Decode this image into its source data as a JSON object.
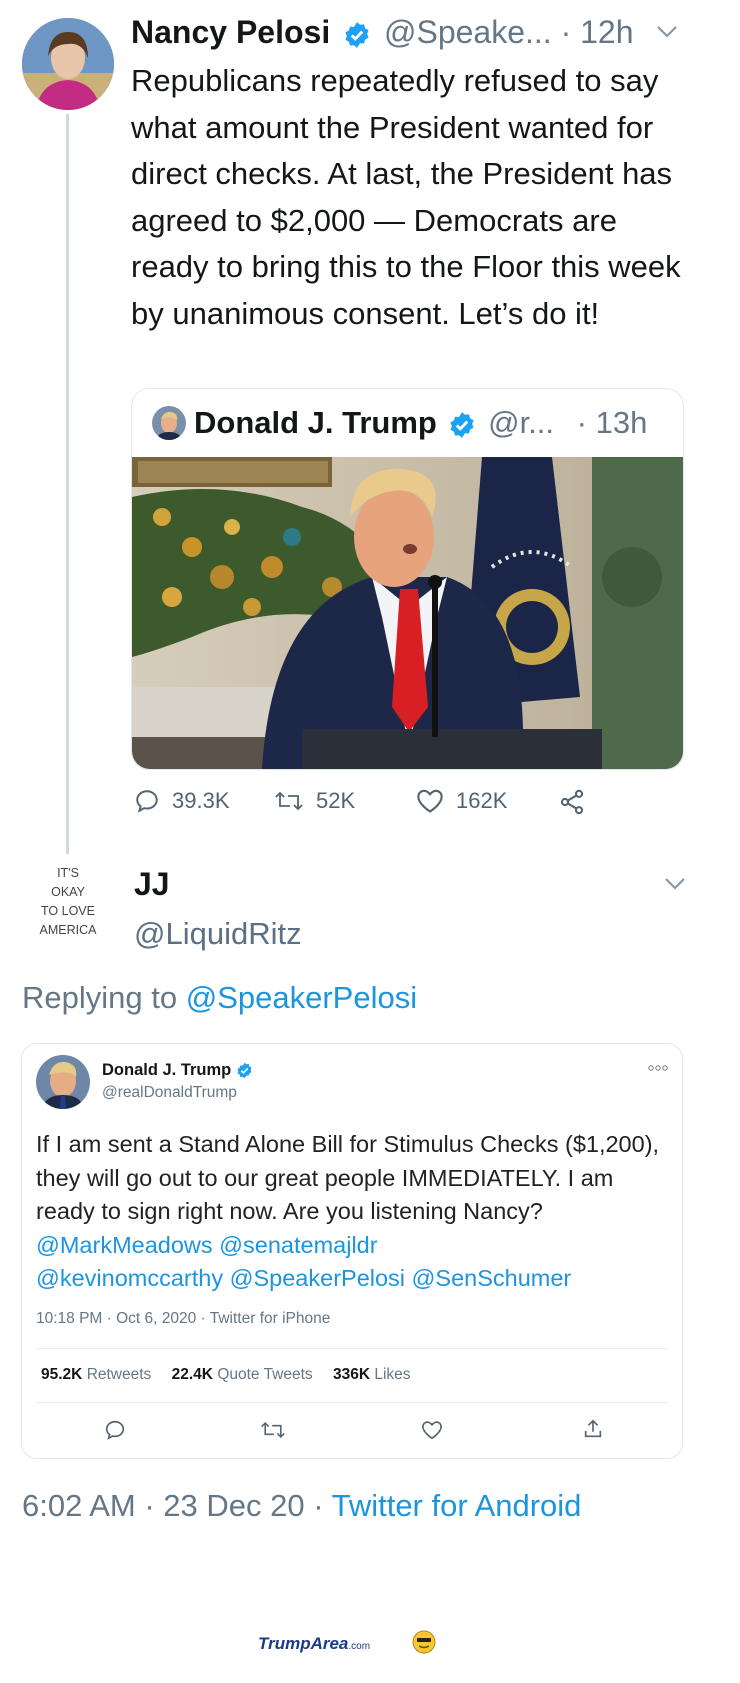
{
  "tweet": {
    "author_name": "Nancy Pelosi",
    "handle": "@Speake...",
    "time": "· 12h",
    "text": "Republicans repeatedly refused to say what amount the President wanted for direct checks. At last, the President has agreed to $2,000 — Democrats are ready to bring this to the Floor this week by unanimous consent. Let’s do it!",
    "quote": {
      "author_name": "Donald J. Trump",
      "handle": "@r...",
      "time": "· 13h"
    },
    "actions": {
      "replies": "39.3K",
      "retweets": "52K",
      "likes": "162K"
    }
  },
  "reply": {
    "avatar_text": [
      "IT'S",
      "OKAY",
      "TO LOVE",
      "AMERICA"
    ],
    "author_name": "JJ",
    "handle": "@LiquidRitz",
    "replying_prefix": "Replying to",
    "replying_handle": "@SpeakerPelosi",
    "embedded": {
      "author_name": "Donald J. Trump",
      "handle": "@realDonaldTrump",
      "text_plain": "If I am sent a Stand Alone Bill for Stimulus Checks ($1,200), they will go out to our great people IMMEDIATELY. I am ready to sign right now. Are you listening Nancy?",
      "mentions_1": "@MarkMeadows @senatemajldr",
      "mentions_2": "@kevinomccarthy @SpeakerPelosi @SenSchumer",
      "timestamp": "10:18 PM · Oct 6, 2020 · Twitter for iPhone",
      "retweets_count": "95.2K",
      "retweets_label": "Retweets",
      "quotes_count": "22.4K",
      "quotes_label": "Quote Tweets",
      "likes_count": "336K",
      "likes_label": "Likes"
    },
    "timestamp": "6:02 AM · 23 Dec 20 · ",
    "source": "Twitter for Android"
  },
  "watermark": {
    "brand_main": "TrumpArea",
    "brand_suffix": ".com"
  },
  "colors": {
    "link_blue": "#1b95e0",
    "text_grey": "#657786",
    "watermark_blue": "#1a3a8c"
  }
}
